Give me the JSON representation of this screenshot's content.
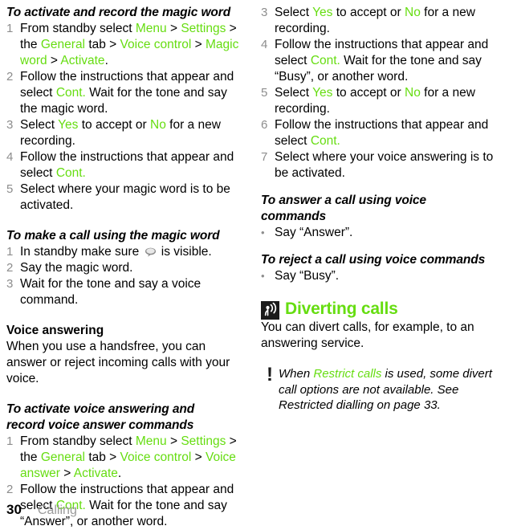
{
  "colors": {
    "accent_green": "#66dd11",
    "number_gray": "#8d8d8d",
    "footer_gray": "#9a9a9a",
    "icon_dark": "#1b1b1b"
  },
  "footer": {
    "page_number": "30",
    "chapter_name": "Calling"
  },
  "left_column": {
    "proc1": {
      "heading": "To activate and record the magic word",
      "steps": [
        {
          "num": "1",
          "parts": [
            {
              "t": "From standby select ",
              "c": "plain"
            },
            {
              "t": "Menu",
              "c": "ui"
            },
            {
              "t": " > ",
              "c": "plain"
            },
            {
              "t": "Settings",
              "c": "ui"
            },
            {
              "t": " > the ",
              "c": "plain"
            },
            {
              "t": "General",
              "c": "ui"
            },
            {
              "t": " tab > ",
              "c": "plain"
            },
            {
              "t": "Voice control",
              "c": "ui"
            },
            {
              "t": " > ",
              "c": "plain"
            },
            {
              "t": "Magic word",
              "c": "ui"
            },
            {
              "t": " > ",
              "c": "plain"
            },
            {
              "t": "Activate",
              "c": "ui"
            },
            {
              "t": ".",
              "c": "plain"
            }
          ]
        },
        {
          "num": "2",
          "parts": [
            {
              "t": "Follow the instructions that appear and select ",
              "c": "plain"
            },
            {
              "t": "Cont.",
              "c": "ui"
            },
            {
              "t": " Wait for the tone and say the magic word.",
              "c": "plain"
            }
          ]
        },
        {
          "num": "3",
          "parts": [
            {
              "t": "Select ",
              "c": "plain"
            },
            {
              "t": "Yes",
              "c": "ui"
            },
            {
              "t": " to accept or ",
              "c": "plain"
            },
            {
              "t": "No",
              "c": "ui"
            },
            {
              "t": " for a new recording.",
              "c": "plain"
            }
          ]
        },
        {
          "num": "4",
          "parts": [
            {
              "t": "Follow the instructions that appear and select ",
              "c": "plain"
            },
            {
              "t": "Cont.",
              "c": "ui"
            }
          ]
        },
        {
          "num": "5",
          "parts": [
            {
              "t": "Select where your magic word is to be activated.",
              "c": "plain"
            }
          ]
        }
      ]
    },
    "proc2": {
      "heading": "To make a call using the magic word",
      "steps": [
        {
          "num": "1",
          "parts": [
            {
              "t": "In standby make sure ",
              "c": "plain"
            },
            {
              "t": "",
              "c": "bubble-icon"
            },
            {
              "t": " is visible.",
              "c": "plain"
            }
          ]
        },
        {
          "num": "2",
          "parts": [
            {
              "t": "Say the magic word.",
              "c": "plain"
            }
          ]
        },
        {
          "num": "3",
          "parts": [
            {
              "t": "Wait for the tone and say a voice command.",
              "c": "plain"
            }
          ]
        }
      ]
    },
    "voice_answering": {
      "heading": "Voice answering",
      "body": "When you use a handsfree, you can answer or reject incoming calls with your voice."
    },
    "proc3": {
      "heading_line1": "To activate voice answering and",
      "heading_line2": "record voice answer commands",
      "steps": [
        {
          "num": "1",
          "parts": [
            {
              "t": "From standby select ",
              "c": "plain"
            },
            {
              "t": "Menu",
              "c": "ui"
            },
            {
              "t": " > ",
              "c": "plain"
            },
            {
              "t": "Settings",
              "c": "ui"
            },
            {
              "t": " > the ",
              "c": "plain"
            },
            {
              "t": "General",
              "c": "ui"
            },
            {
              "t": " tab > ",
              "c": "plain"
            },
            {
              "t": "Voice control",
              "c": "ui"
            },
            {
              "t": " > ",
              "c": "plain"
            },
            {
              "t": "Voice answer",
              "c": "ui"
            },
            {
              "t": " > ",
              "c": "plain"
            },
            {
              "t": "Activate",
              "c": "ui"
            },
            {
              "t": ".",
              "c": "plain"
            }
          ]
        },
        {
          "num": "2",
          "parts": [
            {
              "t": "Follow the instructions that appear and select ",
              "c": "plain"
            },
            {
              "t": "Cont.",
              "c": "ui"
            },
            {
              "t": " Wait for the tone and say “Answer”, or another word.",
              "c": "plain"
            }
          ]
        }
      ]
    }
  },
  "right_column": {
    "proc3_cont": {
      "steps": [
        {
          "num": "3",
          "parts": [
            {
              "t": "Select ",
              "c": "plain"
            },
            {
              "t": "Yes",
              "c": "ui"
            },
            {
              "t": " to accept or ",
              "c": "plain"
            },
            {
              "t": "No",
              "c": "ui"
            },
            {
              "t": " for a new recording.",
              "c": "plain"
            }
          ]
        },
        {
          "num": "4",
          "parts": [
            {
              "t": "Follow the instructions that appear and select ",
              "c": "plain"
            },
            {
              "t": "Cont.",
              "c": "ui"
            },
            {
              "t": " Wait for the tone and say “Busy”, or another word.",
              "c": "plain"
            }
          ]
        },
        {
          "num": "5",
          "parts": [
            {
              "t": "Select ",
              "c": "plain"
            },
            {
              "t": "Yes",
              "c": "ui"
            },
            {
              "t": " to accept or ",
              "c": "plain"
            },
            {
              "t": "No",
              "c": "ui"
            },
            {
              "t": " for a new recording.",
              "c": "plain"
            }
          ]
        },
        {
          "num": "6",
          "parts": [
            {
              "t": "Follow the instructions that appear and select ",
              "c": "plain"
            },
            {
              "t": "Cont.",
              "c": "ui"
            }
          ]
        },
        {
          "num": "7",
          "parts": [
            {
              "t": "Select where your voice answering is to be activated.",
              "c": "plain"
            }
          ]
        }
      ]
    },
    "proc4": {
      "heading_line1": "To answer a call using voice",
      "heading_line2": "commands",
      "bullets": [
        {
          "dot": "•",
          "parts": [
            {
              "t": "Say “Answer”.",
              "c": "plain"
            }
          ]
        }
      ]
    },
    "proc5": {
      "heading": "To reject a call using voice commands",
      "bullets": [
        {
          "dot": "•",
          "parts": [
            {
              "t": "Say “Busy”.",
              "c": "plain"
            }
          ]
        }
      ]
    },
    "chapter": {
      "icon_name": "diverting-calls-icon",
      "title": "Diverting calls",
      "body": "You can divert calls, for example, to an answering service."
    },
    "note": {
      "icon": "!",
      "parts": [
        {
          "t": "When ",
          "c": "plain"
        },
        {
          "t": "Restrict calls",
          "c": "ui"
        },
        {
          "t": " is used, some divert call options are not available. See Restricted dialling on page 33.",
          "c": "plain"
        }
      ]
    }
  }
}
